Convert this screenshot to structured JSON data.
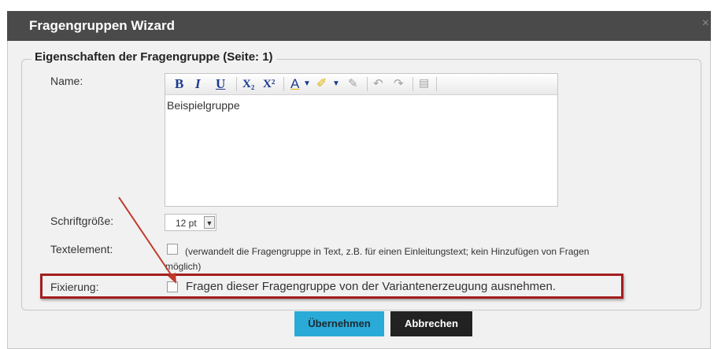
{
  "window": {
    "title": "Fragengruppen Wizard",
    "close_symbol": "×"
  },
  "section": {
    "legend": "Eigenschaften der Fragengruppe (Seite: 1)"
  },
  "fields": {
    "name_label": "Name:",
    "name_value": "Beispielgruppe",
    "fontsize_label": "Schriftgröße:",
    "fontsize_value": "12 pt",
    "textelement_label": "Textelement:",
    "textelement_desc_line1": "(verwandelt die Fragengruppe in Text, z.B. für einen Einleitungstext; kein Hinzufügen von Fragen",
    "textelement_desc_line2": "möglich)",
    "fixierung_label": "Fixierung:",
    "fixierung_desc": "Fragen dieser Fragengruppe von der Variantenerzeugung ausnehmen."
  },
  "toolbar": {
    "bold": "B",
    "italic": "I",
    "underline": "U",
    "subscript": "X₂",
    "superscript": "X²",
    "font_color": "A",
    "icons": [
      "bold-icon",
      "italic-icon",
      "underline-icon",
      "subscript-icon",
      "superscript-icon",
      "font-color-icon",
      "highlight-icon",
      "clear-format-icon",
      "undo-icon",
      "redo-icon",
      "paste-icon"
    ]
  },
  "buttons": {
    "ok": "Übernehmen",
    "cancel": "Abbrechen"
  },
  "colors": {
    "titlebar": "#4a4a4a",
    "accent_button": "#2aaad6",
    "cancel_button": "#222222",
    "highlight_border": "#a31e1e"
  }
}
